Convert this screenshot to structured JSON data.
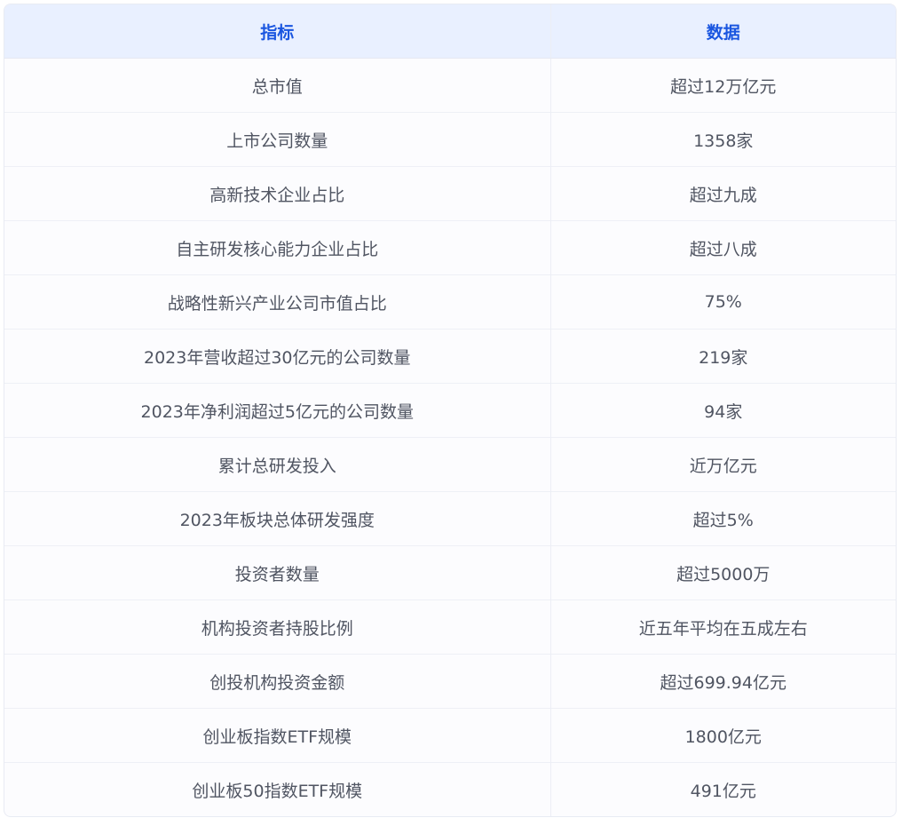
{
  "table": {
    "headers": [
      "指标",
      "数据"
    ],
    "rows": [
      [
        "总市值",
        "超过12万亿元"
      ],
      [
        "上市公司数量",
        "1358家"
      ],
      [
        "高新技术企业占比",
        "超过九成"
      ],
      [
        "自主研发核心能力企业占比",
        "超过八成"
      ],
      [
        "战略性新兴产业公司市值占比",
        "75%"
      ],
      [
        "2023年营收超过30亿元的公司数量",
        "219家"
      ],
      [
        "2023年净利润超过5亿元的公司数量",
        "94家"
      ],
      [
        "累计总研发投入",
        "近万亿元"
      ],
      [
        "2023年板块总体研发强度",
        "超过5%"
      ],
      [
        "投资者数量",
        "超过5000万"
      ],
      [
        "机构投资者持股比例",
        "近五年平均在五成左右"
      ],
      [
        "创投机构投资金额",
        "超过699.94亿元"
      ],
      [
        "创业板指数ETF规模",
        "1800亿元"
      ],
      [
        "创业板50指数ETF规模",
        "491亿元"
      ]
    ]
  },
  "colors": {
    "header_bg": "#e9f0ff",
    "header_text": "#1a56e0",
    "cell_text": "#505562",
    "border": "#e8ebf3"
  }
}
